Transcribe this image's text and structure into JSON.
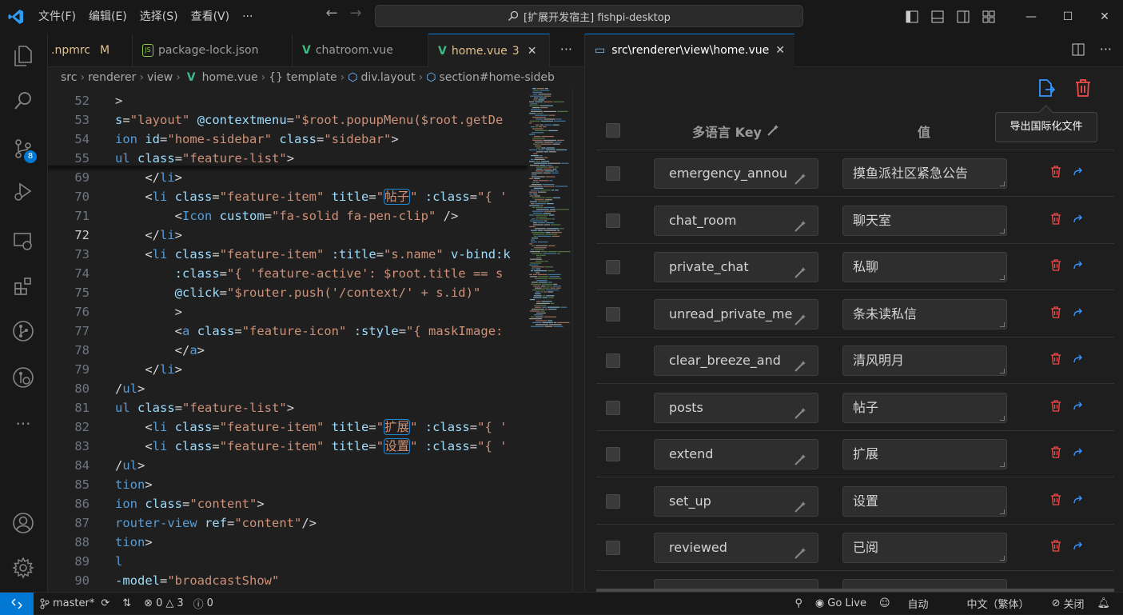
{
  "menu": [
    "文件(F)",
    "编辑(E)",
    "选择(S)",
    "查看(V)",
    "···"
  ],
  "command_center": "[扩展开发宿主] fishpi-desktop",
  "activity": {
    "source_control_badge": "8"
  },
  "tabs": [
    {
      "label": ".npmrc",
      "badge": "M"
    },
    {
      "label": "package-lock.json"
    },
    {
      "label": "chatroom.vue"
    },
    {
      "label": "home.vue",
      "badge": "3"
    }
  ],
  "breadcrumb": [
    "src",
    "renderer",
    "view",
    "home.vue",
    "{} template",
    "div.layout",
    "section#home-sideb"
  ],
  "code_lines": [
    {
      "n": "52",
      "parts": [
        [
          "t",
          ">"
        ]
      ]
    },
    {
      "n": "53",
      "parts": [
        [
          "attr",
          "s"
        ],
        [
          "pl",
          "="
        ],
        [
          "str",
          "\"layout\""
        ],
        [
          "pl",
          " "
        ],
        [
          "attr",
          "@contextmenu"
        ],
        [
          "pl",
          "="
        ],
        [
          "str",
          "\"$root.popupMenu($root.getDe"
        ]
      ]
    },
    {
      "n": "54",
      "parts": [
        [
          "tag",
          "ion"
        ],
        [
          "pl",
          " "
        ],
        [
          "attr",
          "id"
        ],
        [
          "pl",
          "="
        ],
        [
          "str",
          "\"home-sidebar\""
        ],
        [
          "pl",
          " "
        ],
        [
          "attr",
          "class"
        ],
        [
          "pl",
          "="
        ],
        [
          "str",
          "\"sidebar\""
        ],
        [
          "pl",
          ">"
        ]
      ]
    },
    {
      "n": "55",
      "parts": [
        [
          "tag",
          "ul"
        ],
        [
          "pl",
          " "
        ],
        [
          "attr",
          "class"
        ],
        [
          "pl",
          "="
        ],
        [
          "str",
          "\"feature-list\""
        ],
        [
          "pl",
          ">"
        ]
      ]
    },
    {
      "n": "69",
      "parts": [
        [
          "pl",
          "    </"
        ],
        [
          "tag",
          "li"
        ],
        [
          "pl",
          ">"
        ]
      ]
    },
    {
      "n": "70",
      "parts": [
        [
          "pl",
          "    <"
        ],
        [
          "tag",
          "li"
        ],
        [
          "pl",
          " "
        ],
        [
          "attr",
          "class"
        ],
        [
          "pl",
          "="
        ],
        [
          "str",
          "\"feature-item\""
        ],
        [
          "pl",
          " "
        ],
        [
          "attr",
          "title"
        ],
        [
          "pl",
          "="
        ],
        [
          "str",
          "\""
        ],
        [
          "strhl",
          "帖子"
        ],
        [
          "str",
          "\""
        ],
        [
          "pl",
          " "
        ],
        [
          "attr",
          ":class"
        ],
        [
          "pl",
          "="
        ],
        [
          "str",
          "\"{ '"
        ]
      ]
    },
    {
      "n": "71",
      "parts": [
        [
          "pl",
          "        <"
        ],
        [
          "tag",
          "Icon"
        ],
        [
          "pl",
          " "
        ],
        [
          "attr",
          "custom"
        ],
        [
          "pl",
          "="
        ],
        [
          "str",
          "\"fa-solid fa-pen-clip\""
        ],
        [
          "pl",
          " />"
        ]
      ]
    },
    {
      "n": "72",
      "parts": [
        [
          "pl",
          "    </"
        ],
        [
          "tag",
          "li"
        ],
        [
          "pl",
          ">"
        ]
      ]
    },
    {
      "n": "73",
      "parts": [
        [
          "pl",
          "    <"
        ],
        [
          "tag",
          "li"
        ],
        [
          "pl",
          " "
        ],
        [
          "attr",
          "class"
        ],
        [
          "pl",
          "="
        ],
        [
          "str",
          "\"feature-item\""
        ],
        [
          "pl",
          " "
        ],
        [
          "attr",
          ":title"
        ],
        [
          "pl",
          "="
        ],
        [
          "str",
          "\"s.name\""
        ],
        [
          "pl",
          " "
        ],
        [
          "attr",
          "v-bind:k"
        ]
      ]
    },
    {
      "n": "74",
      "parts": [
        [
          "pl",
          "        "
        ],
        [
          "attr",
          ":class"
        ],
        [
          "pl",
          "="
        ],
        [
          "str",
          "\"{ 'feature-active': $root.title == s"
        ]
      ]
    },
    {
      "n": "75",
      "parts": [
        [
          "pl",
          "        "
        ],
        [
          "attr",
          "@click"
        ],
        [
          "pl",
          "="
        ],
        [
          "str",
          "\"$router.push('/context/' + s.id)\""
        ]
      ]
    },
    {
      "n": "76",
      "parts": [
        [
          "pl",
          "        >"
        ]
      ]
    },
    {
      "n": "77",
      "parts": [
        [
          "pl",
          "        <"
        ],
        [
          "tag",
          "a"
        ],
        [
          "pl",
          " "
        ],
        [
          "attr",
          "class"
        ],
        [
          "pl",
          "="
        ],
        [
          "str",
          "\"feature-icon\""
        ],
        [
          "pl",
          " "
        ],
        [
          "attr",
          ":style"
        ],
        [
          "pl",
          "="
        ],
        [
          "str",
          "\"{ maskImage: "
        ]
      ]
    },
    {
      "n": "78",
      "parts": [
        [
          "pl",
          "        </"
        ],
        [
          "tag",
          "a"
        ],
        [
          "pl",
          ">"
        ]
      ]
    },
    {
      "n": "79",
      "parts": [
        [
          "pl",
          "    </"
        ],
        [
          "tag",
          "li"
        ],
        [
          "pl",
          ">"
        ]
      ]
    },
    {
      "n": "80",
      "parts": [
        [
          "pl",
          "/"
        ],
        [
          "tag",
          "ul"
        ],
        [
          "pl",
          ">"
        ]
      ]
    },
    {
      "n": "81",
      "parts": [
        [
          "tag",
          "ul"
        ],
        [
          "pl",
          " "
        ],
        [
          "attr",
          "class"
        ],
        [
          "pl",
          "="
        ],
        [
          "str",
          "\"feature-list\""
        ],
        [
          "pl",
          ">"
        ]
      ]
    },
    {
      "n": "82",
      "parts": [
        [
          "pl",
          "    <"
        ],
        [
          "tag",
          "li"
        ],
        [
          "pl",
          " "
        ],
        [
          "attr",
          "class"
        ],
        [
          "pl",
          "="
        ],
        [
          "str",
          "\"feature-item\""
        ],
        [
          "pl",
          " "
        ],
        [
          "attr",
          "title"
        ],
        [
          "pl",
          "="
        ],
        [
          "str",
          "\""
        ],
        [
          "strhl",
          "扩展"
        ],
        [
          "str",
          "\""
        ],
        [
          "pl",
          " "
        ],
        [
          "attr",
          ":class"
        ],
        [
          "pl",
          "="
        ],
        [
          "str",
          "\"{ '"
        ]
      ]
    },
    {
      "n": "83",
      "parts": [
        [
          "pl",
          "    <"
        ],
        [
          "tag",
          "li"
        ],
        [
          "pl",
          " "
        ],
        [
          "attr",
          "class"
        ],
        [
          "pl",
          "="
        ],
        [
          "str",
          "\"feature-item\""
        ],
        [
          "pl",
          " "
        ],
        [
          "attr",
          "title"
        ],
        [
          "pl",
          "="
        ],
        [
          "str",
          "\""
        ],
        [
          "strhl",
          "设置"
        ],
        [
          "str",
          "\""
        ],
        [
          "pl",
          " "
        ],
        [
          "attr",
          ":class"
        ],
        [
          "pl",
          "="
        ],
        [
          "str",
          "\"{ '"
        ]
      ]
    },
    {
      "n": "84",
      "parts": [
        [
          "pl",
          "/"
        ],
        [
          "tag",
          "ul"
        ],
        [
          "pl",
          ">"
        ]
      ]
    },
    {
      "n": "85",
      "parts": [
        [
          "tag",
          "tion"
        ],
        [
          "pl",
          ">"
        ]
      ]
    },
    {
      "n": "86",
      "parts": [
        [
          "tag",
          "ion"
        ],
        [
          "pl",
          " "
        ],
        [
          "attr",
          "class"
        ],
        [
          "pl",
          "="
        ],
        [
          "str",
          "\"content\""
        ],
        [
          "pl",
          ">"
        ]
      ]
    },
    {
      "n": "87",
      "parts": [
        [
          "tag",
          "router-view"
        ],
        [
          "pl",
          " "
        ],
        [
          "attr",
          "ref"
        ],
        [
          "pl",
          "="
        ],
        [
          "str",
          "\"content\""
        ],
        [
          "pl",
          "/>"
        ]
      ]
    },
    {
      "n": "88",
      "parts": [
        [
          "tag",
          "tion"
        ],
        [
          "pl",
          ">"
        ]
      ]
    },
    {
      "n": "89",
      "parts": [
        [
          "tag",
          "l"
        ]
      ]
    },
    {
      "n": "90",
      "parts": [
        [
          "attr",
          "-model"
        ],
        [
          "pl",
          "="
        ],
        [
          "str",
          "\"broadcastShow\""
        ]
      ]
    }
  ],
  "current_line": "72",
  "panel": {
    "tab_label": "src\\renderer\\view\\home.vue",
    "tooltip": "导出国际化文件",
    "header_key": "多语言 Key",
    "header_value": "值",
    "rows": [
      {
        "key": "emergency_annou",
        "value": "摸鱼派社区紧急公告"
      },
      {
        "key": "chat_room",
        "value": "聊天室"
      },
      {
        "key": "private_chat",
        "value": "私聊"
      },
      {
        "key": "unread_private_me",
        "value": "条未读私信"
      },
      {
        "key": "clear_breeze_and",
        "value": "清风明月"
      },
      {
        "key": "posts",
        "value": "帖子"
      },
      {
        "key": "extend",
        "value": "扩展"
      },
      {
        "key": "set_up",
        "value": "设置"
      },
      {
        "key": "reviewed",
        "value": "已阅"
      }
    ]
  },
  "status": {
    "branch": "master*",
    "errors": "0",
    "warnings": "3",
    "info": "0",
    "go_live": "Go Live",
    "auto": "自动",
    "lang": "中文（繁体）",
    "close": "关闭"
  },
  "colors": {
    "accent": "#0078d4",
    "danger": "#f14c4c",
    "link": "#3794ff"
  }
}
